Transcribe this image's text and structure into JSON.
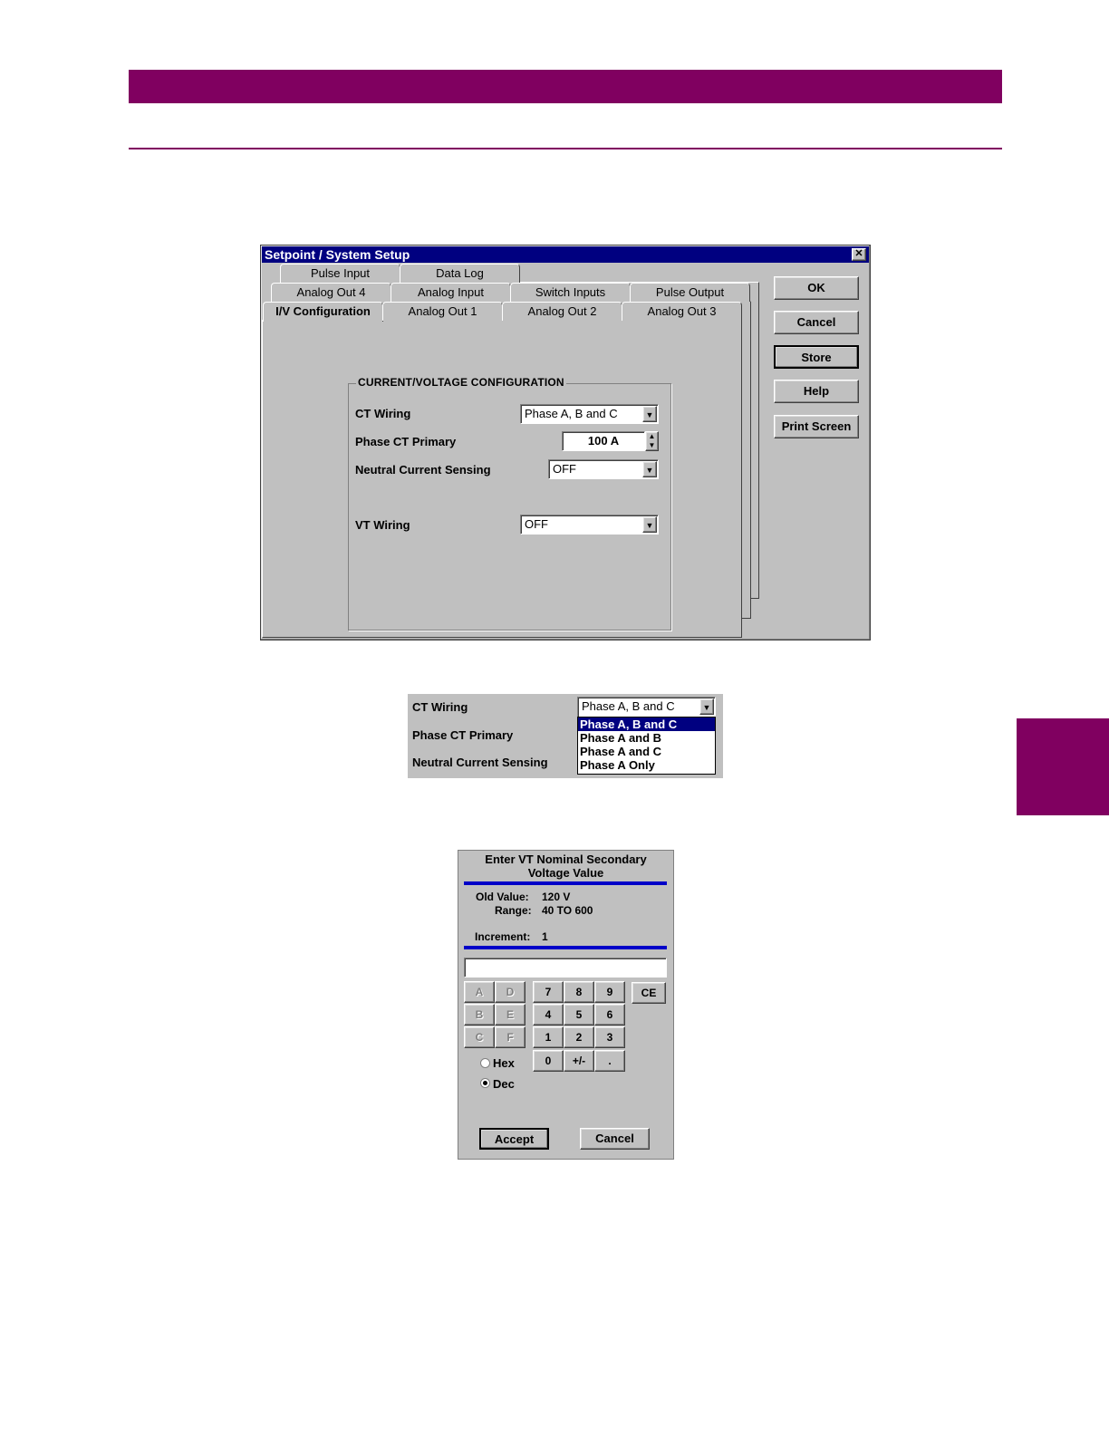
{
  "dialog": {
    "title": "Setpoint  /  System Setup",
    "close_glyph": "✕",
    "tabs_row1": [
      "Pulse Input",
      "Data Log"
    ],
    "tabs_row2": [
      "Analog Out 4",
      "Analog Input",
      "Switch Inputs",
      "Pulse Output"
    ],
    "tabs_row3": [
      "I/V Configuration",
      "Analog Out 1",
      "Analog Out 2",
      "Analog Out 3"
    ],
    "group_title": "CURRENT/VOLTAGE CONFIGURATION",
    "fields": {
      "ct_wiring_label": "CT Wiring",
      "ct_wiring_value": "Phase A, B and C",
      "phase_ct_label": "Phase CT Primary",
      "phase_ct_value": "100 A",
      "neutral_label": "Neutral Current Sensing",
      "neutral_value": "OFF",
      "vt_wiring_label": "VT Wiring",
      "vt_wiring_value": "OFF"
    },
    "buttons": [
      "OK",
      "Cancel",
      "Store",
      "Help",
      "Print Screen"
    ]
  },
  "dropdown_excerpt": {
    "ct_wiring_label": "CT Wiring",
    "phase_ct_label": "Phase CT Primary",
    "neutral_label": "Neutral Current Sensing",
    "selected_value": "Phase A, B and C",
    "options": [
      "Phase A, B and C",
      "Phase A and B",
      "Phase A and C",
      "Phase A Only"
    ]
  },
  "keypad": {
    "title_line1": "Enter VT Nominal Secondary",
    "title_line2": "Voltage Value",
    "old_value_label": "Old Value:",
    "old_value": "120 V",
    "range_label": "Range:",
    "range": "40 TO 600",
    "increment_label": "Increment:",
    "increment": "1",
    "input_value": "",
    "hex_keys": [
      "A",
      "D",
      "B",
      "E",
      "C",
      "F"
    ],
    "digit_keys": [
      "7",
      "8",
      "9",
      "4",
      "5",
      "6",
      "1",
      "2",
      "3",
      "0",
      "+/-",
      "."
    ],
    "ce_label": "CE",
    "radio_hex": "Hex",
    "radio_dec": "Dec",
    "accept_label": "Accept",
    "cancel_label": "Cancel"
  }
}
